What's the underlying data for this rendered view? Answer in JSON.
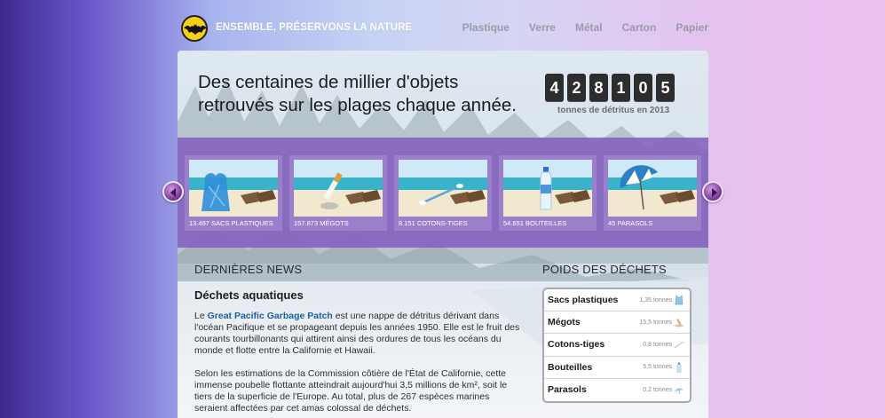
{
  "header": {
    "site_title": "ENSEMBLE, PRÉSERVONS LA NATURE",
    "nav": [
      "Plastique",
      "Verre",
      "Métal",
      "Carton",
      "Papier"
    ]
  },
  "hero": {
    "line1": "Des centaines de millier d'objets",
    "line2": "retrouvés sur les plages chaque année.",
    "counter_digits": [
      "4",
      "2",
      "8",
      "1",
      "0",
      "5"
    ],
    "counter_caption": "tonnes de détritus en 2013"
  },
  "carousel": {
    "items": [
      {
        "caption": "13.497 SACS PLASTIQUES",
        "icon": "plastic-bag-icon"
      },
      {
        "caption": "157.873 MÉGOTS",
        "icon": "cigarette-icon"
      },
      {
        "caption": "8.151 COTONS-TIGES",
        "icon": "cotton-swab-icon"
      },
      {
        "caption": "54.651 BOUTEILLES",
        "icon": "bottle-icon"
      },
      {
        "caption": "45 PARASOLS",
        "icon": "parasol-icon"
      }
    ]
  },
  "news": {
    "section_title": "DERNIÈRES NEWS",
    "article_title": "Déchets aquatiques",
    "para1_prefix": "Le ",
    "para1_link": "Great Pacific Garbage Patch",
    "para1_rest": " est une nappe de détritus dérivant dans l'océan Pacifique et se propageant depuis les années 1950. Elle est le fruit des courants tourbillonants qui attirent ainsi des ordures de tous les océans du monde et flotte entre la Californie et Hawaii.",
    "para2": "Selon les estimations de la Commission côtière de l'État de Californie, cette immense poubelle flottante atteindrait aujourd'hui 3,5 millions de km², soit le tiers de la superficie de l'Europe. Au total, plus de 267 espèces marines seraient affectées par cet amas colossal de déchets."
  },
  "weights": {
    "section_title": "POIDS DES DÉCHETS",
    "rows": [
      {
        "name": "Sacs plastiques",
        "value": "1,35 tonnes",
        "icon": "plastic-bag-icon"
      },
      {
        "name": "Mégots",
        "value": "15,5 tonnes",
        "icon": "cigarette-icon"
      },
      {
        "name": "Cotons-tiges",
        "value": "0,8 tonnes",
        "icon": "cotton-swab-icon"
      },
      {
        "name": "Bouteilles",
        "value": "5,5 tonnes",
        "icon": "bottle-icon"
      },
      {
        "name": "Parasols",
        "value": "0,2 tonnes",
        "icon": "parasol-icon"
      }
    ]
  },
  "colors": {
    "accent_purple": "#8360be",
    "link_blue": "#1b5fa0",
    "counter_bg": "#2d2d2d"
  }
}
